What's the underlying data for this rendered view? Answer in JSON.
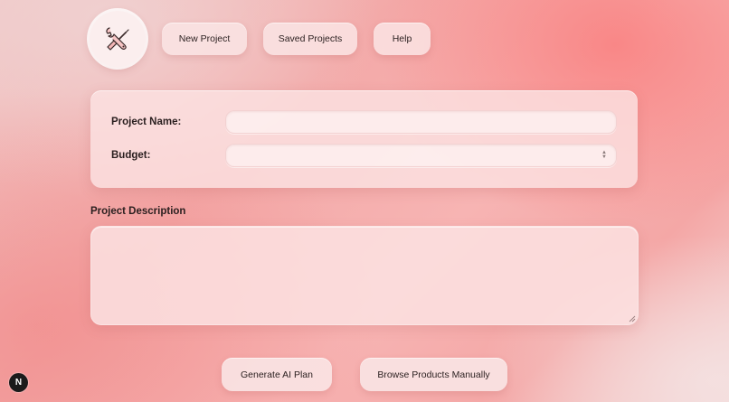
{
  "header": {
    "logo_icon": "tools-wrench-screwdriver-icon",
    "nav": {
      "new_project": "New Project",
      "saved_projects": "Saved Projects",
      "help": "Help"
    }
  },
  "form": {
    "project_name_label": "Project Name:",
    "project_name_value": "",
    "budget_label": "Budget:",
    "budget_value": ""
  },
  "description": {
    "label": "Project Description",
    "value": ""
  },
  "actions": {
    "generate_ai_plan": "Generate AI Plan",
    "browse_products": "Browse Products Manually"
  },
  "badge": {
    "text": "N"
  },
  "colors": {
    "accent": "#f3a9a8",
    "card": "#fbe2e2",
    "text": "#2a1f1f",
    "badge": "#1b1b1b"
  }
}
